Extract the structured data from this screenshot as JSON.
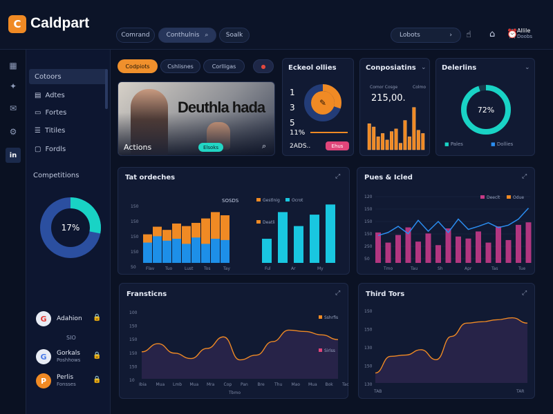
{
  "app": {
    "logo_letter": "C",
    "name": "Caldpart"
  },
  "header": {
    "pills": [
      "Comrand",
      "Conthulnis",
      "Soalk"
    ],
    "search_label": "Lobots",
    "user_name": "Allile",
    "user_sub": "Doobs",
    "icons": [
      "chevron-right-icon",
      "cursor-icon",
      "home-icon",
      "alarm-icon"
    ]
  },
  "rail": {
    "icons": [
      "dashboard-icon",
      "twitter-icon",
      "chat-icon",
      "settings-icon",
      "linkedin-icon"
    ]
  },
  "sidebar": {
    "items": [
      {
        "label": "Cotoors",
        "icon": "none"
      },
      {
        "label": "Adtes",
        "icon": "docs-icon"
      },
      {
        "label": "Fortes",
        "icon": "folder-icon"
      },
      {
        "label": "Titiles",
        "icon": "list-icon"
      },
      {
        "label": "Fordls",
        "icon": "file-icon"
      }
    ],
    "section_label": "Competitions",
    "donut_label": "17%",
    "donut_fraction": 0.28,
    "contacts": [
      {
        "name": "Adahion",
        "sub": "",
        "avatar": "G",
        "color": "#e23b35"
      },
      {
        "name": "Gorkals",
        "sub": "Poshhows",
        "avatar": "G",
        "color": "#4a7be8"
      },
      {
        "name": "Perlis",
        "sub": "Fonsses",
        "avatar": "P",
        "color": "#c8384a"
      }
    ],
    "divider_label": "SIO"
  },
  "tabs": [
    "Codpiots",
    "Cshlisnes",
    "Corlligas"
  ],
  "hero": {
    "headline": "Deuthla hada",
    "caption": "Actions",
    "button": "Elsoks"
  },
  "schedule": {
    "title": "Eckeol ollies",
    "numbers": [
      "1",
      "3",
      "5"
    ],
    "value": "11%",
    "sub_value": "2ADS..",
    "button": "Ehus",
    "donut_fraction": 0.3
  },
  "compositions": {
    "title": "Conposiatins",
    "legend": [
      "Comor Cosge",
      "Colmo"
    ],
    "value": "215,00.",
    "bars": [
      40,
      35,
      20,
      25,
      15,
      28,
      32,
      10,
      45,
      20,
      65,
      30,
      25
    ]
  },
  "deliveries": {
    "title": "Delerlins",
    "value": "72%",
    "fraction": 0.95,
    "legend": [
      "Pales",
      "Dollies"
    ]
  },
  "tot_orders": {
    "title": "Tat ordeches",
    "badge": "SOSDS",
    "legend": [
      "Gestlnig",
      "Ocrot"
    ],
    "legend2": "Deatli",
    "y_ticks": [
      "150",
      "150",
      "150",
      "150",
      "50"
    ],
    "x_labels": [
      "Flav",
      "Tuo",
      "Lust",
      "Tos",
      "Tay"
    ],
    "x_labels2": [
      "Ful",
      "Ar",
      "My"
    ]
  },
  "pues": {
    "title": "Pues & Icled",
    "legend": [
      "Deeclt",
      "Odue"
    ],
    "y_ticks": [
      "120",
      "150",
      "150",
      "150",
      "250",
      "50"
    ],
    "x_labels": [
      "Tmo",
      "Tau",
      "Sh",
      "Apr",
      "Tas",
      "Tue"
    ]
  },
  "transactions": {
    "title": "Fransticns",
    "legend": [
      "Sshrfis",
      "Sirlss"
    ],
    "y_ticks": [
      "100",
      "150",
      "150",
      "150",
      "150",
      "10"
    ],
    "x_labels": [
      "Ibia",
      "Mua",
      "Lmb",
      "Mua",
      "Mra",
      "Cop",
      "Pan",
      "Bre",
      "Thu",
      "Mao",
      "Mua",
      "Bok",
      "Tac"
    ],
    "x_footer": "Tbmo"
  },
  "third": {
    "title": "Third Tors",
    "y_ticks": [
      "150",
      "150",
      "130",
      "150",
      "130"
    ],
    "x_first": "TAB",
    "x_last": "TAR"
  },
  "chart_data": [
    {
      "type": "bar",
      "title": "Tat ordeches",
      "categories": [
        "Flav",
        "",
        "Tuo",
        "",
        "Lust",
        "",
        "Tos",
        "",
        "Tay"
      ],
      "series": [
        {
          "name": "Gestlnig",
          "values": [
            45,
            57,
            52,
            62,
            58,
            63,
            70,
            80,
            75
          ]
        },
        {
          "name": "Ocrot",
          "values": [
            32,
            42,
            35,
            38,
            30,
            40,
            30,
            38,
            36
          ]
        }
      ],
      "ylim": [
        0,
        100
      ]
    },
    {
      "type": "bar",
      "title": "",
      "categories": [
        "Ful",
        "",
        "Ar",
        "",
        "My"
      ],
      "series": [
        {
          "name": "Deatli",
          "values": [
            38,
            80,
            58,
            76,
            92
          ]
        }
      ],
      "ylim": [
        0,
        100
      ]
    },
    {
      "type": "bar",
      "title": "Pues & Icled",
      "categories": [
        "Tmo",
        "",
        "",
        "Tau",
        "",
        "",
        "Sh",
        "",
        "Apr",
        "",
        "",
        "Tas",
        "",
        "",
        "Tue",
        ""
      ],
      "series": [
        {
          "name": "Deeclt",
          "values": [
            60,
            40,
            55,
            70,
            42,
            58,
            35,
            68,
            52,
            48,
            62,
            40,
            72,
            45,
            75,
            80
          ]
        },
        {
          "name": "Odue",
          "values": [
            45,
            50,
            60,
            48,
            70,
            52,
            68,
            50,
            72,
            55,
            60,
            66,
            58,
            62,
            72,
            90
          ]
        }
      ],
      "ylim": [
        0,
        100
      ]
    },
    {
      "type": "area",
      "title": "Fransticns",
      "x": [
        "Ibia",
        "Mua",
        "Lmb",
        "Mua",
        "Mra",
        "Cop",
        "Pan",
        "Bre",
        "Thu",
        "Mao",
        "Mua",
        "Bok",
        "Tac"
      ],
      "series": [
        {
          "name": "Sshrfis",
          "values": [
            40,
            52,
            38,
            30,
            45,
            62,
            28,
            35,
            55,
            72,
            70,
            65,
            58
          ]
        }
      ],
      "ylim": [
        0,
        100
      ]
    },
    {
      "type": "area",
      "title": "Third Tors",
      "x": [
        "TAB",
        "",
        "",
        "",
        "",
        "",
        "",
        "",
        "",
        "",
        "TAR"
      ],
      "series": [
        {
          "name": "",
          "values": [
            15,
            40,
            42,
            50,
            35,
            70,
            90,
            92,
            95,
            98,
            90
          ]
        }
      ],
      "ylim": [
        0,
        110
      ]
    }
  ]
}
